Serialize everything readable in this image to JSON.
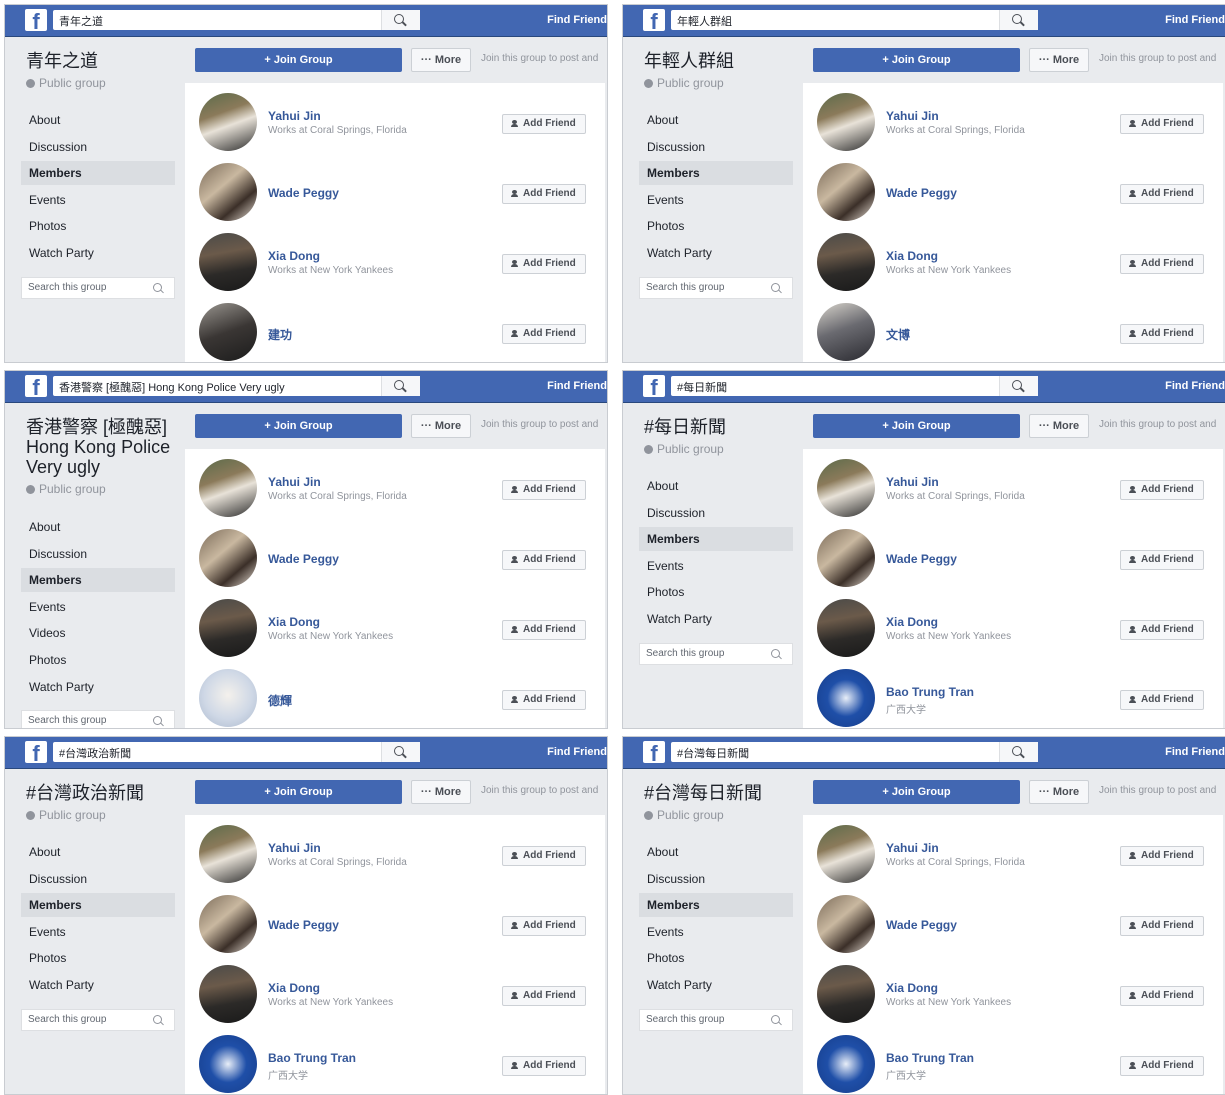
{
  "ui": {
    "logo": "f",
    "find_friends": "Find Friend",
    "join_button": "+ Join Group",
    "more_button": "··· More",
    "join_prompt": "Join this group to post and",
    "public_group": "Public group",
    "group_search_placeholder": "Search this group",
    "add_friend": "Add Friend"
  },
  "panels": [
    {
      "search_text": "青年之道",
      "title": "青年之道",
      "nav": [
        "About",
        "Discussion",
        "Members",
        "Events",
        "Photos",
        "Watch Party"
      ],
      "active_nav": "Members",
      "members": [
        {
          "name": "Yahui Jin",
          "sub": "Works at Coral Springs, Florida"
        },
        {
          "name": "Wade Peggy",
          "sub": ""
        },
        {
          "name": "Xia Dong",
          "sub": "Works at New York Yankees"
        },
        {
          "name": "建功",
          "sub": ""
        }
      ]
    },
    {
      "search_text": "年輕人群組",
      "title": "年輕人群組",
      "nav": [
        "About",
        "Discussion",
        "Members",
        "Events",
        "Photos",
        "Watch Party"
      ],
      "active_nav": "Members",
      "members": [
        {
          "name": "Yahui Jin",
          "sub": "Works at Coral Springs, Florida"
        },
        {
          "name": "Wade Peggy",
          "sub": ""
        },
        {
          "name": "Xia Dong",
          "sub": "Works at New York Yankees"
        },
        {
          "name": "文博",
          "sub": ""
        }
      ]
    },
    {
      "search_text": "香港警察 [極醜惡]  Hong Kong Police Very ugly",
      "title": "香港警察 [極醜惡] Hong Kong Police Very ugly",
      "nav": [
        "About",
        "Discussion",
        "Members",
        "Events",
        "Videos",
        "Photos",
        "Watch Party"
      ],
      "active_nav": "Members",
      "members": [
        {
          "name": "Yahui Jin",
          "sub": "Works at Coral Springs, Florida"
        },
        {
          "name": "Wade Peggy",
          "sub": ""
        },
        {
          "name": "Xia Dong",
          "sub": "Works at New York Yankees"
        },
        {
          "name": "德輝",
          "sub": ""
        }
      ]
    },
    {
      "search_text": "#每日新聞",
      "title": "#每日新聞",
      "nav": [
        "About",
        "Discussion",
        "Members",
        "Events",
        "Photos",
        "Watch Party"
      ],
      "active_nav": "Members",
      "members": [
        {
          "name": "Yahui Jin",
          "sub": "Works at Coral Springs, Florida"
        },
        {
          "name": "Wade Peggy",
          "sub": ""
        },
        {
          "name": "Xia Dong",
          "sub": "Works at New York Yankees"
        },
        {
          "name": "Bao Trung Tran",
          "sub": "广西大学"
        }
      ]
    },
    {
      "search_text": "#台灣政治新聞",
      "title": "#台灣政治新聞",
      "nav": [
        "About",
        "Discussion",
        "Members",
        "Events",
        "Photos",
        "Watch Party"
      ],
      "active_nav": "Members",
      "members": [
        {
          "name": "Yahui Jin",
          "sub": "Works at Coral Springs, Florida"
        },
        {
          "name": "Wade Peggy",
          "sub": ""
        },
        {
          "name": "Xia Dong",
          "sub": "Works at New York Yankees"
        },
        {
          "name": "Bao Trung Tran",
          "sub": "广西大学"
        }
      ]
    },
    {
      "search_text": "#台灣每日新聞",
      "title": "#台灣每日新聞",
      "nav": [
        "About",
        "Discussion",
        "Members",
        "Events",
        "Photos",
        "Watch Party"
      ],
      "active_nav": "Members",
      "members": [
        {
          "name": "Yahui Jin",
          "sub": "Works at Coral Springs, Florida"
        },
        {
          "name": "Wade Peggy",
          "sub": ""
        },
        {
          "name": "Xia Dong",
          "sub": "Works at New York Yankees"
        },
        {
          "name": "Bao Trung Tran",
          "sub": "广西大学"
        }
      ]
    }
  ]
}
